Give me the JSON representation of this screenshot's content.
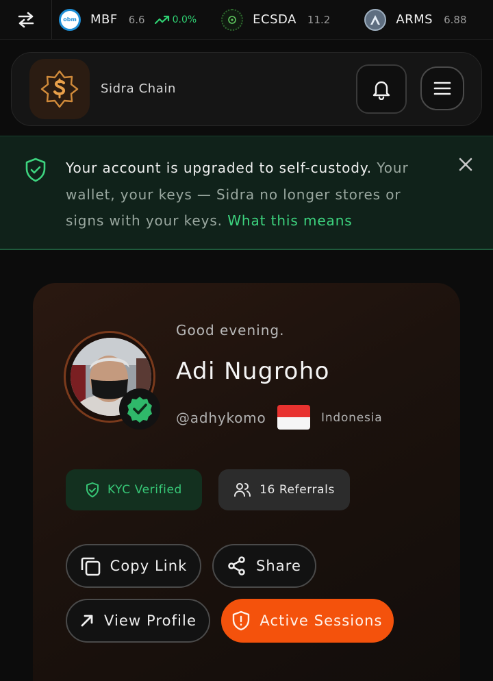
{
  "ticker": {
    "items": [
      {
        "symbol": "MBF",
        "price": "6.6",
        "change": "0.0%",
        "logo_text": "obm",
        "logo_color": "#1f8fd6"
      },
      {
        "symbol": "ECSDA",
        "price": "11.2",
        "change": "",
        "logo_color": "#1a3a1a"
      },
      {
        "symbol": "ARMS",
        "price": "6.88",
        "change": "",
        "logo_color": "#6c7c8c"
      }
    ],
    "up_color": "#2fd072"
  },
  "header": {
    "brand_name": "Sidra Chain",
    "icons": [
      "sidra-logo-icon",
      "bell-icon",
      "menu-icon"
    ]
  },
  "banner": {
    "strong_text": "Your account is upgraded to self-custody.",
    "body_text": " Your wallet, your keys — Sidra no longer stores or signs with your keys. ",
    "link_text": "What this means",
    "accent": "#3dd47f"
  },
  "profile": {
    "greeting": "Good evening.",
    "name": "Adi Nugroho",
    "handle": "@adhykomo",
    "country": "Indonesia",
    "kyc_label": "KYC Verified",
    "referrals_label": "16 Referrals",
    "referral_count": 16
  },
  "actions": {
    "copy_link": "Copy Link",
    "share": "Share",
    "view_profile": "View Profile",
    "active_sessions": "Active Sessions",
    "accent": "#f4520c"
  }
}
